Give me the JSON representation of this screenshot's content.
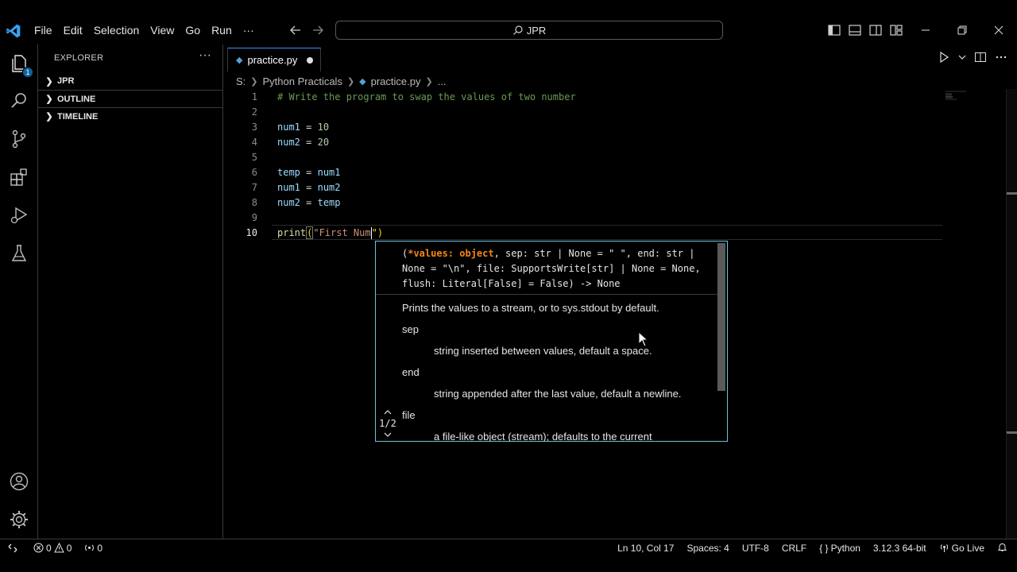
{
  "window": {
    "menu": [
      "File",
      "Edit",
      "Selection",
      "View",
      "Go",
      "Run",
      "···"
    ],
    "search_text": "JPR"
  },
  "sidebar": {
    "title": "EXPLORER",
    "more": "···",
    "sections": [
      "JPR",
      "OUTLINE",
      "TIMELINE"
    ],
    "explorer_badge": "1"
  },
  "editor": {
    "tab_label": "practice.py",
    "breadcrumb": [
      "S:",
      "Python Practicals",
      "practice.py",
      "..."
    ],
    "lines": [
      {
        "n": "1",
        "kind": "comment",
        "text": "# Write the program to swap the values of two number"
      },
      {
        "n": "2",
        "kind": "blank",
        "text": ""
      },
      {
        "n": "3",
        "kind": "assign",
        "var": "num1",
        "op": " = ",
        "val": "10"
      },
      {
        "n": "4",
        "kind": "assign",
        "var": "num2",
        "op": " = ",
        "val": "20"
      },
      {
        "n": "5",
        "kind": "blank",
        "text": ""
      },
      {
        "n": "6",
        "kind": "assign2",
        "var": "temp",
        "op": " = ",
        "val": "num1"
      },
      {
        "n": "7",
        "kind": "assign2",
        "var": "num1",
        "op": " = ",
        "val": "num2"
      },
      {
        "n": "8",
        "kind": "assign2",
        "var": "num2",
        "op": " = ",
        "val": "temp"
      },
      {
        "n": "9",
        "kind": "blank",
        "text": ""
      },
      {
        "n": "10",
        "kind": "call",
        "fn": "print",
        "open": "(",
        "str": "\"First Num",
        "close": "\")"
      }
    ],
    "active_line": "10"
  },
  "signature_help": {
    "line1_pre": "(",
    "active_param": "*values: object",
    "line1_post": ", sep: str | None = \" \", end: str |",
    "line2": "None = \"\\n\", file: SupportsWrite[str] | None = None,",
    "line3": "flush: Literal[False] = False) -> None",
    "doc": [
      {
        "text": "Prints the values to a stream, or to sys.stdout by default.",
        "indent": false
      },
      {
        "text": "sep",
        "indent": false
      },
      {
        "text": "string inserted between values, default a space.",
        "indent": true
      },
      {
        "text": "end",
        "indent": false
      },
      {
        "text": "string appended after the last value, default a newline.",
        "indent": true
      },
      {
        "text": "file",
        "indent": false
      },
      {
        "text": "a file-like object (stream); defaults to the current",
        "indent": true
      }
    ],
    "nav_up": "^",
    "overload": "1/2",
    "nav_down": "v"
  },
  "statusbar": {
    "errors": "0",
    "warnings": "0",
    "ports": "0",
    "position": "Ln 10, Col 17",
    "spaces": "Spaces: 4",
    "encoding": "UTF-8",
    "eol": "CRLF",
    "language": "Python",
    "interpreter": "3.12.3 64-bit",
    "live": "Go Live"
  },
  "colors": {
    "accent": "#3794ff",
    "widget_border": "#6fc3df",
    "comment": "#6a9955",
    "number": "#b5cea8",
    "string": "#ce9178",
    "active_param": "#f38518"
  }
}
